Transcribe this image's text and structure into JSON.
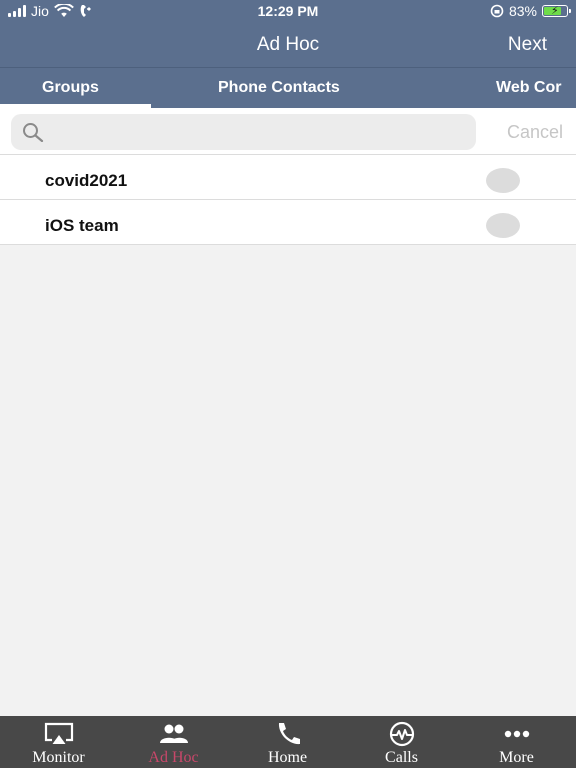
{
  "status": {
    "carrier": "Jio",
    "time": "12:29 PM",
    "battery": "83%",
    "battery_level": 0.83
  },
  "nav": {
    "title": "Ad Hoc",
    "next_label": "Next"
  },
  "tabs": [
    {
      "label": "Groups",
      "active": true
    },
    {
      "label": "Phone Contacts",
      "active": false
    },
    {
      "label": "Web Cor",
      "active": false
    }
  ],
  "search": {
    "placeholder": "",
    "value": "",
    "cancel_label": "Cancel"
  },
  "groups": [
    {
      "name": "covid2021"
    },
    {
      "name": "iOS team"
    }
  ],
  "tabbar": {
    "items": [
      {
        "label": "Monitor",
        "icon": "airplay-icon"
      },
      {
        "label": "Ad Hoc",
        "icon": "users-icon",
        "active": true
      },
      {
        "label": "Home",
        "icon": "phone-icon"
      },
      {
        "label": "Calls",
        "icon": "pulse-icon"
      },
      {
        "label": "More",
        "icon": "more-dots-icon"
      }
    ]
  },
  "colors": {
    "header": "#5b6f8e",
    "tabbar": "#484848",
    "active_tab": "#c8476a"
  }
}
